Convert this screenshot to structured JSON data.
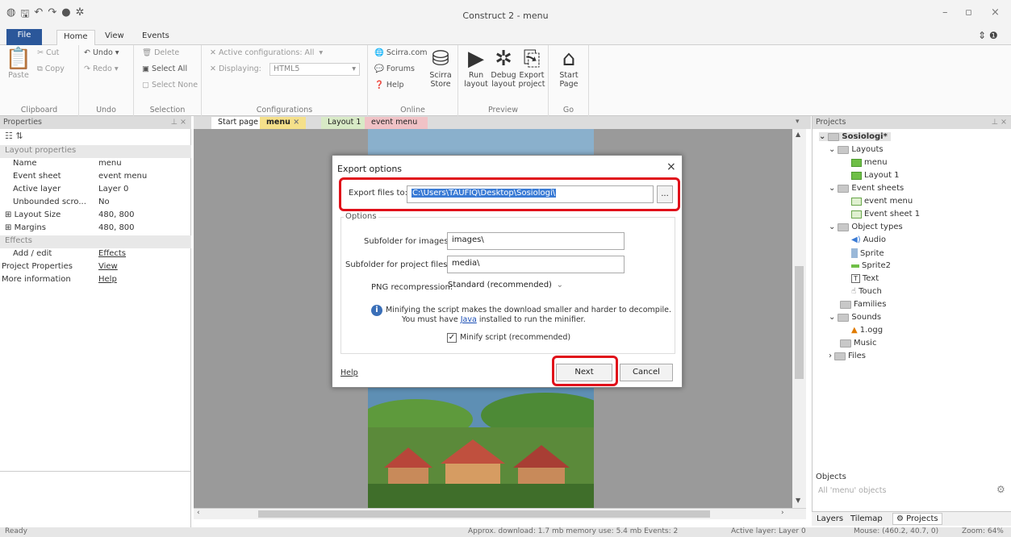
{
  "window": {
    "title": "Construct 2 - menu",
    "minimize": "–",
    "restore": "▫",
    "close": "×"
  },
  "ribbon_tabs": [
    {
      "label": "File"
    },
    {
      "label": "Home"
    },
    {
      "label": "View"
    },
    {
      "label": "Events"
    }
  ],
  "ribbon": {
    "clipboard": {
      "paste": "Paste",
      "cut": "Cut",
      "copy": "Copy",
      "label": "Clipboard"
    },
    "undo": {
      "undo": "Undo",
      "redo": "Redo",
      "label": "Undo"
    },
    "selection": {
      "delete": "Delete",
      "select_all": "Select All",
      "select_none": "Select None",
      "label": "Selection"
    },
    "configurations": {
      "active": "Active configurations: All",
      "displaying": "Displaying:",
      "mode": "HTML5",
      "label": "Configurations"
    },
    "online": {
      "scirra": "Scirra.com",
      "forums": "Forums",
      "help": "Help",
      "store_l1": "Scirra",
      "store_l2": "Store",
      "label": "Online"
    },
    "preview": {
      "run_l1": "Run",
      "run_l2": "layout",
      "debug_l1": "Debug",
      "debug_l2": "layout",
      "export_l1": "Export",
      "export_l2": "project",
      "label": "Preview"
    },
    "go": {
      "start_l1": "Start",
      "start_l2": "Page",
      "label": "Go"
    }
  },
  "properties": {
    "header": "Properties",
    "rows": [
      {
        "key": "Layout properties",
        "value": ""
      },
      {
        "key": "Name",
        "value": "menu"
      },
      {
        "key": "Event sheet",
        "value": "event menu"
      },
      {
        "key": "Active layer",
        "value": "Layer 0"
      },
      {
        "key": "Unbounded scro...",
        "value": "No"
      },
      {
        "key": "Layout Size",
        "value": "480, 800"
      },
      {
        "key": "Margins",
        "value": "480, 800"
      },
      {
        "key": "Effects",
        "value": ""
      },
      {
        "key": "Add / edit",
        "value": "Effects"
      },
      {
        "key": "Project Properties",
        "value": "View"
      },
      {
        "key": "More information",
        "value": "Help"
      }
    ]
  },
  "doc_tabs": [
    {
      "label": "Start page"
    },
    {
      "label": "menu"
    },
    {
      "label": "Layout 1"
    },
    {
      "label": "event menu"
    }
  ],
  "projects": {
    "header": "Projects",
    "nodes": [
      {
        "label": "Sosiologi*"
      },
      {
        "label": "Layouts"
      },
      {
        "label": "menu"
      },
      {
        "label": "Layout 1"
      },
      {
        "label": "Event sheets"
      },
      {
        "label": "event menu"
      },
      {
        "label": "Event sheet 1"
      },
      {
        "label": "Object types"
      },
      {
        "label": "Audio"
      },
      {
        "label": "Sprite"
      },
      {
        "label": "Sprite2"
      },
      {
        "label": "Text"
      },
      {
        "label": "Touch"
      },
      {
        "label": "Families"
      },
      {
        "label": "Sounds"
      },
      {
        "label": "1.ogg"
      },
      {
        "label": "Music"
      },
      {
        "label": "Files"
      }
    ]
  },
  "objects": {
    "header": "Objects",
    "filter": "All 'menu' objects"
  },
  "bottom_tabs": [
    {
      "label": "Layers"
    },
    {
      "label": "Tilemap"
    },
    {
      "label": "Projects"
    }
  ],
  "status": {
    "left": "Ready",
    "download": "Approx. download: 1.7 mb  memory use: 5.4 mb  Events: 2",
    "layer": "Active layer: Layer 0",
    "mouse": "Mouse: (460.2, 40.7, 0)",
    "zoom": "Zoom: 64%"
  },
  "dialog": {
    "title": "Export options",
    "export_label": "Export files to:",
    "export_path": "C:\\Users\\TAUFIQ\\Desktop\\Sosiologi\\",
    "browse": "...",
    "options_label": "Options",
    "subfolder_images_label": "Subfolder for images:",
    "subfolder_images": "images\\",
    "subfolder_project_label": "Subfolder for project files:",
    "subfolder_project": "media\\",
    "png_label": "PNG recompression:",
    "png_value": "Standard (recommended)",
    "note_l1": "Minifying the script makes the download smaller and harder to decompile.",
    "note_l2a": "You must have",
    "note_java": "Java",
    "note_l2b": "installed to run the minifier.",
    "minify_label": "Minify script (recommended)",
    "help": "Help",
    "next": "Next",
    "cancel": "Cancel"
  },
  "colors": {
    "accent_red": "#e0101a",
    "file_tab": "#2b579a",
    "selection": "#3a7bd5"
  }
}
